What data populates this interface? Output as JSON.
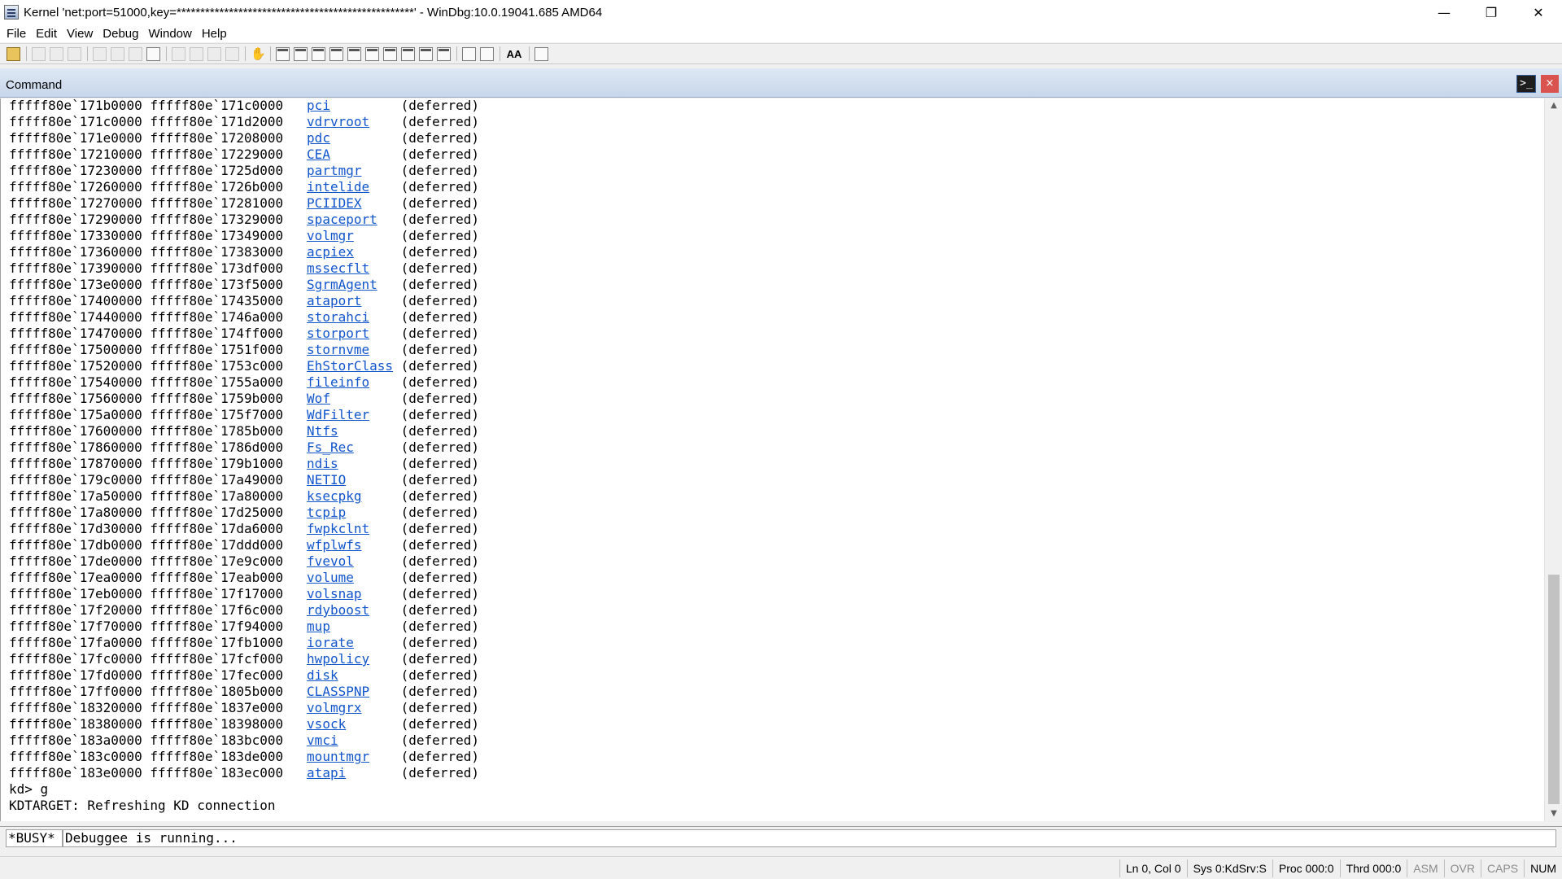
{
  "window": {
    "title": "Kernel 'net:port=51000,key=**************************************************' - WinDbg:10.0.19041.685 AMD64",
    "minimize": "—",
    "maximize": "❐",
    "close": "✕"
  },
  "menu": [
    "File",
    "Edit",
    "View",
    "Debug",
    "Window",
    "Help"
  ],
  "toolbar": {
    "font_button": "AA"
  },
  "command_pane": {
    "title": "Command",
    "prompt_icon": ">_",
    "close": "×"
  },
  "output": {
    "lines": [
      {
        "start": "fffff80e`171b0000",
        "end": "fffff80e`171c0000",
        "module": "pci",
        "status": "(deferred)"
      },
      {
        "start": "fffff80e`171c0000",
        "end": "fffff80e`171d2000",
        "module": "vdrvroot",
        "status": "(deferred)"
      },
      {
        "start": "fffff80e`171e0000",
        "end": "fffff80e`17208000",
        "module": "pdc",
        "status": "(deferred)"
      },
      {
        "start": "fffff80e`17210000",
        "end": "fffff80e`17229000",
        "module": "CEA",
        "status": "(deferred)"
      },
      {
        "start": "fffff80e`17230000",
        "end": "fffff80e`1725d000",
        "module": "partmgr",
        "status": "(deferred)"
      },
      {
        "start": "fffff80e`17260000",
        "end": "fffff80e`1726b000",
        "module": "intelide",
        "status": "(deferred)"
      },
      {
        "start": "fffff80e`17270000",
        "end": "fffff80e`17281000",
        "module": "PCIIDEX",
        "status": "(deferred)"
      },
      {
        "start": "fffff80e`17290000",
        "end": "fffff80e`17329000",
        "module": "spaceport",
        "status": "(deferred)"
      },
      {
        "start": "fffff80e`17330000",
        "end": "fffff80e`17349000",
        "module": "volmgr",
        "status": "(deferred)"
      },
      {
        "start": "fffff80e`17360000",
        "end": "fffff80e`17383000",
        "module": "acpiex",
        "status": "(deferred)"
      },
      {
        "start": "fffff80e`17390000",
        "end": "fffff80e`173df000",
        "module": "mssecflt",
        "status": "(deferred)"
      },
      {
        "start": "fffff80e`173e0000",
        "end": "fffff80e`173f5000",
        "module": "SgrmAgent",
        "status": "(deferred)"
      },
      {
        "start": "fffff80e`17400000",
        "end": "fffff80e`17435000",
        "module": "ataport",
        "status": "(deferred)"
      },
      {
        "start": "fffff80e`17440000",
        "end": "fffff80e`1746a000",
        "module": "storahci",
        "status": "(deferred)"
      },
      {
        "start": "fffff80e`17470000",
        "end": "fffff80e`174ff000",
        "module": "storport",
        "status": "(deferred)"
      },
      {
        "start": "fffff80e`17500000",
        "end": "fffff80e`1751f000",
        "module": "stornvme",
        "status": "(deferred)"
      },
      {
        "start": "fffff80e`17520000",
        "end": "fffff80e`1753c000",
        "module": "EhStorClass",
        "status": "(deferred)"
      },
      {
        "start": "fffff80e`17540000",
        "end": "fffff80e`1755a000",
        "module": "fileinfo",
        "status": "(deferred)"
      },
      {
        "start": "fffff80e`17560000",
        "end": "fffff80e`1759b000",
        "module": "Wof",
        "status": "(deferred)"
      },
      {
        "start": "fffff80e`175a0000",
        "end": "fffff80e`175f7000",
        "module": "WdFilter",
        "status": "(deferred)"
      },
      {
        "start": "fffff80e`17600000",
        "end": "fffff80e`1785b000",
        "module": "Ntfs",
        "status": "(deferred)"
      },
      {
        "start": "fffff80e`17860000",
        "end": "fffff80e`1786d000",
        "module": "Fs_Rec",
        "status": "(deferred)"
      },
      {
        "start": "fffff80e`17870000",
        "end": "fffff80e`179b1000",
        "module": "ndis",
        "status": "(deferred)"
      },
      {
        "start": "fffff80e`179c0000",
        "end": "fffff80e`17a49000",
        "module": "NETIO",
        "status": "(deferred)"
      },
      {
        "start": "fffff80e`17a50000",
        "end": "fffff80e`17a80000",
        "module": "ksecpkg",
        "status": "(deferred)"
      },
      {
        "start": "fffff80e`17a80000",
        "end": "fffff80e`17d25000",
        "module": "tcpip",
        "status": "(deferred)"
      },
      {
        "start": "fffff80e`17d30000",
        "end": "fffff80e`17da6000",
        "module": "fwpkclnt",
        "status": "(deferred)"
      },
      {
        "start": "fffff80e`17db0000",
        "end": "fffff80e`17ddd000",
        "module": "wfplwfs",
        "status": "(deferred)"
      },
      {
        "start": "fffff80e`17de0000",
        "end": "fffff80e`17e9c000",
        "module": "fvevol",
        "status": "(deferred)"
      },
      {
        "start": "fffff80e`17ea0000",
        "end": "fffff80e`17eab000",
        "module": "volume",
        "status": "(deferred)"
      },
      {
        "start": "fffff80e`17eb0000",
        "end": "fffff80e`17f17000",
        "module": "volsnap",
        "status": "(deferred)"
      },
      {
        "start": "fffff80e`17f20000",
        "end": "fffff80e`17f6c000",
        "module": "rdyboost",
        "status": "(deferred)"
      },
      {
        "start": "fffff80e`17f70000",
        "end": "fffff80e`17f94000",
        "module": "mup",
        "status": "(deferred)"
      },
      {
        "start": "fffff80e`17fa0000",
        "end": "fffff80e`17fb1000",
        "module": "iorate",
        "status": "(deferred)"
      },
      {
        "start": "fffff80e`17fc0000",
        "end": "fffff80e`17fcf000",
        "module": "hwpolicy",
        "status": "(deferred)"
      },
      {
        "start": "fffff80e`17fd0000",
        "end": "fffff80e`17fec000",
        "module": "disk",
        "status": "(deferred)"
      },
      {
        "start": "fffff80e`17ff0000",
        "end": "fffff80e`1805b000",
        "module": "CLASSPNP",
        "status": "(deferred)"
      },
      {
        "start": "fffff80e`18320000",
        "end": "fffff80e`1837e000",
        "module": "volmgrx",
        "status": "(deferred)"
      },
      {
        "start": "fffff80e`18380000",
        "end": "fffff80e`18398000",
        "module": "vsock",
        "status": "(deferred)"
      },
      {
        "start": "fffff80e`183a0000",
        "end": "fffff80e`183bc000",
        "module": "vmci",
        "status": "(deferred)"
      },
      {
        "start": "fffff80e`183c0000",
        "end": "fffff80e`183de000",
        "module": "mountmgr",
        "status": "(deferred)"
      },
      {
        "start": "fffff80e`183e0000",
        "end": "fffff80e`183ec000",
        "module": "atapi",
        "status": "(deferred)"
      }
    ],
    "prompt_line": "kd> g",
    "message_line": "KDTARGET: Refreshing KD connection"
  },
  "command_input": {
    "busy_label": "*BUSY*",
    "value": "Debuggee is running..."
  },
  "status_bar": [
    {
      "text": "Ln 0, Col 0",
      "enabled": true
    },
    {
      "text": "Sys 0:KdSrv:S",
      "enabled": true
    },
    {
      "text": "Proc 000:0",
      "enabled": true
    },
    {
      "text": "Thrd 000:0",
      "enabled": true
    },
    {
      "text": "ASM",
      "enabled": false
    },
    {
      "text": "OVR",
      "enabled": false
    },
    {
      "text": "CAPS",
      "enabled": false
    },
    {
      "text": "NUM",
      "enabled": true
    }
  ],
  "scrollbar": {
    "up": "▲",
    "down": "▼"
  }
}
